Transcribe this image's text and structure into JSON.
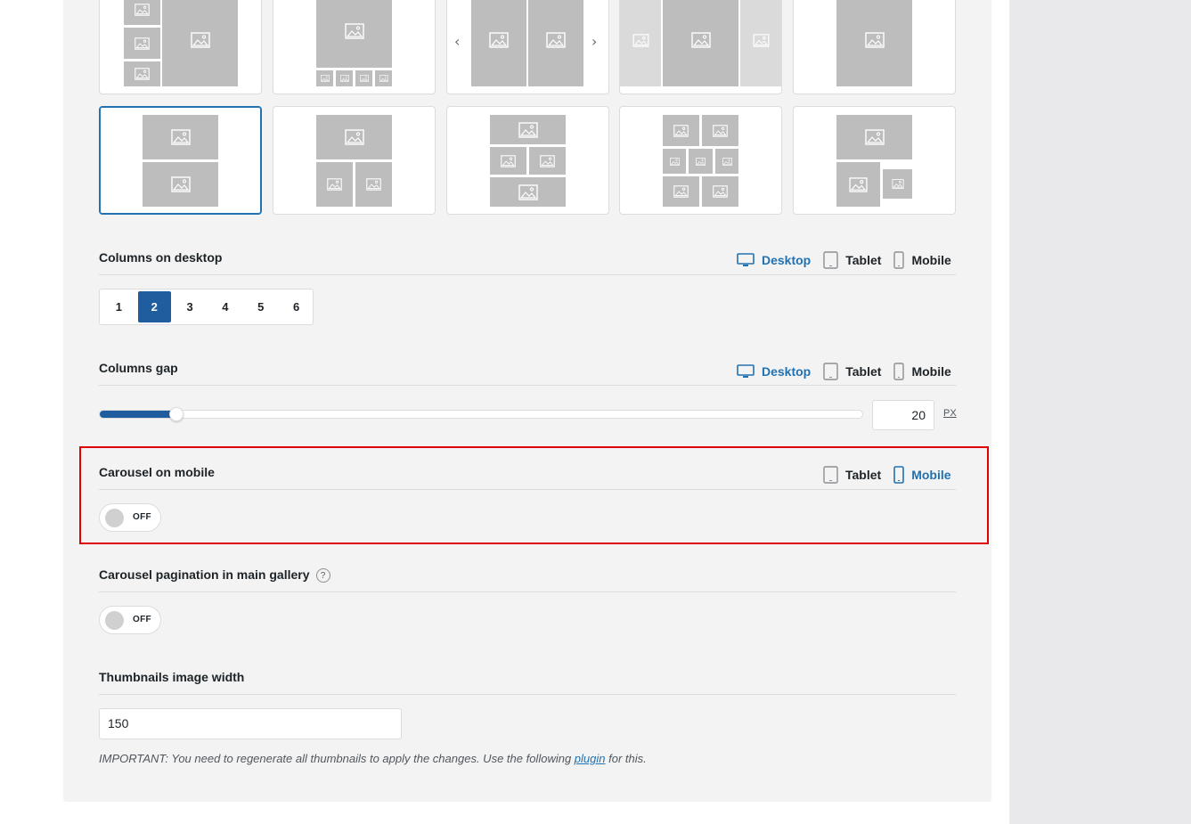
{
  "colors": {
    "accent": "#2271b1",
    "active_fill": "#1f5d9e",
    "highlight": "#e00000",
    "panel_bg": "#f3f3f3",
    "placeholder": "#bdbdbd"
  },
  "layouts": {
    "icons": [
      "image-icon",
      "chevron-left-icon",
      "chevron-right-icon"
    ],
    "selected_index": 5
  },
  "columns_desktop": {
    "title": "Columns on desktop",
    "devices": [
      {
        "label": "Desktop",
        "icon": "desktop-icon",
        "active": true
      },
      {
        "label": "Tablet",
        "icon": "tablet-icon",
        "active": false
      },
      {
        "label": "Mobile",
        "icon": "mobile-icon",
        "active": false
      }
    ],
    "options": [
      "1",
      "2",
      "3",
      "4",
      "5",
      "6"
    ],
    "selected": "2"
  },
  "columns_gap": {
    "title": "Columns gap",
    "devices": [
      {
        "label": "Desktop",
        "icon": "desktop-icon",
        "active": true
      },
      {
        "label": "Tablet",
        "icon": "tablet-icon",
        "active": false
      },
      {
        "label": "Mobile",
        "icon": "mobile-icon",
        "active": false
      }
    ],
    "value": "20",
    "unit": "PX",
    "slider_fraction": 0.1
  },
  "carousel_mobile": {
    "title": "Carousel on mobile",
    "devices": [
      {
        "label": "Tablet",
        "icon": "tablet-icon",
        "active": false
      },
      {
        "label": "Mobile",
        "icon": "mobile-icon",
        "active": true
      }
    ],
    "toggle": "OFF"
  },
  "carousel_pagination": {
    "title": "Carousel pagination in main gallery",
    "help": "?",
    "toggle": "OFF"
  },
  "thumb_width": {
    "title": "Thumbnails image width",
    "value": "150",
    "note_prefix": "IMPORTANT: You need to regenerate all thumbnails to apply the changes. Use the following ",
    "note_link": "plugin",
    "note_suffix": " for this."
  }
}
